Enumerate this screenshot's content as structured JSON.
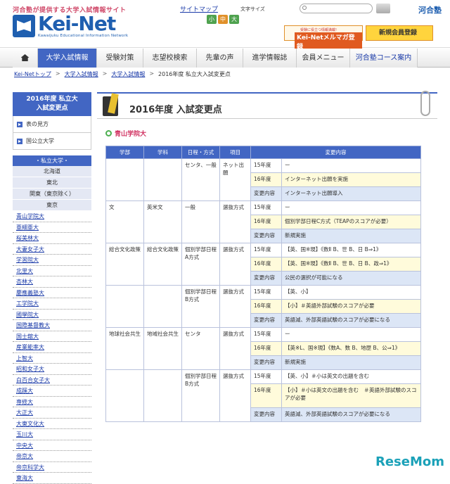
{
  "header": {
    "tagline": "河合塾が提供する大学入試情報サイト",
    "logo_text": "Kei-Net",
    "logo_sub": "Kawaijuku Educational Information Network",
    "sitemap": "サイトマップ",
    "text_size_label": "文字サイズ",
    "text_sizes": [
      "小",
      "中",
      "大"
    ],
    "search_placeholder": "Q-",
    "brand": "河合塾",
    "banner1_small": "受験に役立つ情報満載!",
    "banner1_big": "Kei-Netメルマガ登録",
    "banner2": "新規会員登録"
  },
  "nav": [
    "大学入試情報",
    "受験対策",
    "志望校検索",
    "先輩の声",
    "進学情報誌",
    "会員メニュー",
    "河合塾コース案内"
  ],
  "breadcrumb": [
    "Kei-Netトップ",
    "大学入試情報",
    "大学入試情報",
    "2016年度 私立大入試変更点"
  ],
  "sidebar": {
    "heading": "2016年度 私立大\n入試変更点",
    "links": [
      "表の見方",
      "国公立大学"
    ],
    "category": "・私立大学・",
    "regions": [
      "北海道",
      "東北",
      "関東（東京除く）",
      "東京"
    ],
    "universities": [
      "青山学院大",
      "亜細亜大",
      "桜美林大",
      "大妻女子大",
      "学習院大",
      "北里大",
      "杏林大",
      "慶應義塾大",
      "工学院大",
      "國學院大",
      "国際基督教大",
      "国士舘大",
      "産業能率大",
      "上智大",
      "昭和女子大",
      "白百合女子大",
      "成蹊大",
      "専修大",
      "大正大",
      "大東文化大",
      "玉川大",
      "中央大",
      "帝京大",
      "帝京科学大",
      "東海大"
    ]
  },
  "main": {
    "title": "2016年度 入試変更点",
    "university": "青山学院大",
    "columns": [
      "学部",
      "学科",
      "日程・方式",
      "項目",
      "変更内容"
    ],
    "rows": [
      {
        "faculty": "",
        "dept": "",
        "schedule": "センタ、一般",
        "item": "ネット出願",
        "y15": "ー",
        "y16": "インターネット出願を実施",
        "change": "インターネット出願導入"
      },
      {
        "faculty": "文",
        "dept": "英米文",
        "schedule": "一般",
        "item": "選抜方式",
        "y15": "ー",
        "y16": "個別学部日程C方式（TEAPのスコアが必要）",
        "change": "新規実施"
      },
      {
        "faculty": "総合文化政策",
        "dept": "総合文化政策",
        "schedule": "個別学部日程A方式",
        "item": "選抜方式",
        "y15": "【英、国※現】《数Ⅱ B、世 B、日 B⇒1》",
        "y16": "【英、国※現】《数Ⅱ B、世 B、日 B、政⇒1》",
        "change": "公民の選択が可能になる"
      },
      {
        "faculty": "",
        "dept": "",
        "schedule": "個別学部日程B方式",
        "item": "選抜方式",
        "y15": "【英、小】",
        "y16": "【小】＃英語外部試験のスコアが必要",
        "change": "英語減、外部英語試験のスコアが必要になる"
      },
      {
        "faculty": "地球社会共生",
        "dept": "地域社会共生",
        "schedule": "センタ",
        "item": "選抜方式",
        "y15": "ー",
        "y16": "【英※L、国※現】《数A、数 B、地歴 B、公⇒1》",
        "change": "新規実施"
      },
      {
        "faculty": "",
        "dept": "",
        "schedule": "個別学部日程B方式",
        "item": "選抜方式",
        "y15": "【英、小】＃小は英文の出題を含む",
        "y16": "【小】＃小は英文の出題を含む　＃英語外部試験のスコアが必要",
        "change": "英語減、外部英語試験のスコアが必要になる"
      }
    ],
    "labels": {
      "y15": "15年度",
      "y16": "16年度",
      "change": "変更内容"
    }
  },
  "watermark": "ReseMom"
}
